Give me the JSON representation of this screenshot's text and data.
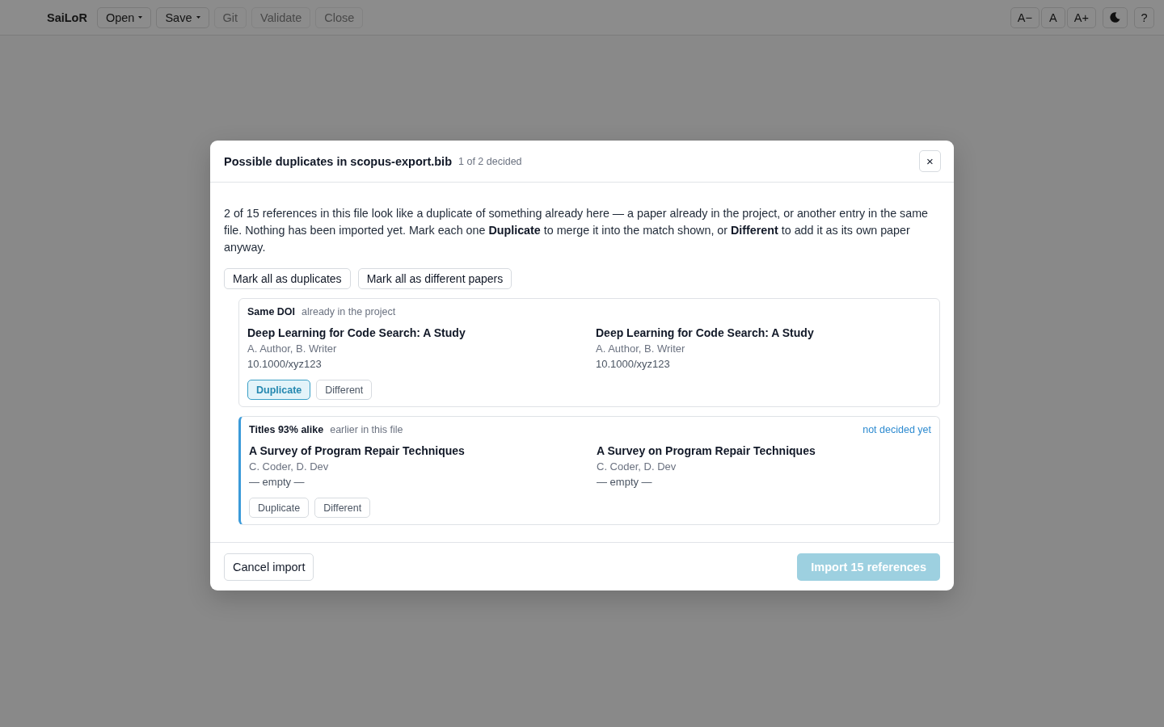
{
  "toolbar": {
    "app_name": "SaiLoR",
    "menus": [
      {
        "label": "Open",
        "kind": "dropdown",
        "disabled": false
      },
      {
        "label": "Save",
        "kind": "dropdown",
        "disabled": false
      },
      {
        "label": "Git",
        "kind": "plain",
        "disabled": true
      },
      {
        "label": "Validate",
        "kind": "plain",
        "disabled": true
      },
      {
        "label": "Close",
        "kind": "plain",
        "disabled": true
      }
    ],
    "font_size_buttons": [
      "A−",
      "A",
      "A+"
    ],
    "help_button": "?"
  },
  "dialog": {
    "title": "Possible duplicates in scopus-export.bib",
    "decided_count": "1 of 2 decided",
    "close": "×",
    "intro": "2 of 15 references in this file look like a duplicate of something already here — a paper already in the project, or another entry in the same file. Nothing has been imported yet. Mark each one **Duplicate** to merge it into the match shown, or **Different** to add it as its own paper anyway.",
    "bulk_actions": [
      "Mark all as duplicates",
      "Mark all as different papers"
    ],
    "matches": [
      {
        "reason": "Same DOI",
        "source": "already in the project",
        "pending": false,
        "entries": [
          {
            "title": "Deep Learning for Code Search: A Study",
            "authors": "A. Author, B. Writer",
            "doi": "10.1000/xyz123"
          },
          {
            "title": "Deep Learning for Code Search: A Study",
            "authors": "A. Author, B. Writer",
            "doi": "10.1000/xyz123"
          }
        ],
        "choices": [
          {
            "label": "Duplicate",
            "selected": true
          },
          {
            "label": "Different",
            "selected": false
          }
        ]
      },
      {
        "reason": "Titles 93% alike",
        "source": "earlier in this file",
        "status": "not decided yet",
        "pending": true,
        "entries": [
          {
            "title": "A Survey of Program Repair Techniques",
            "authors": "C. Coder, D. Dev",
            "doi": "— empty —"
          },
          {
            "title": "A Survey on Program Repair Techniques",
            "authors": "C. Coder, D. Dev",
            "doi": "— empty —"
          }
        ],
        "choices": [
          {
            "label": "Duplicate",
            "selected": false
          },
          {
            "label": "Different",
            "selected": false
          }
        ]
      }
    ],
    "footer": {
      "cancel": "Cancel import",
      "import": {
        "label": "Import 15 references",
        "disabled": true
      }
    }
  }
}
